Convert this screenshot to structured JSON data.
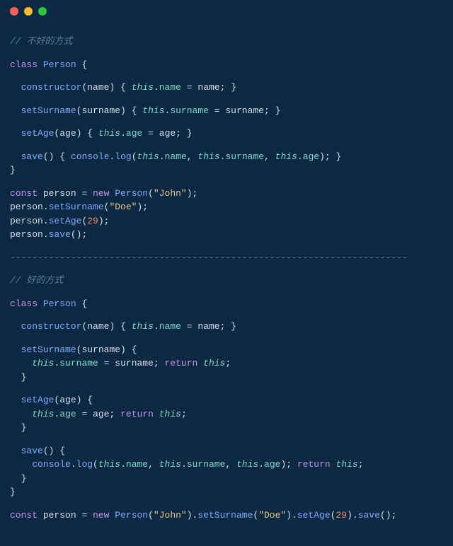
{
  "titlebar": {
    "close": "close",
    "minimize": "minimize",
    "maximize": "maximize"
  },
  "code": {
    "comment_bad": "// 不好的方式",
    "comment_good": "// 好的方式",
    "kw_class": "class",
    "kw_const": "const",
    "kw_new": "new",
    "kw_return": "return",
    "kw_this": "this",
    "cls_Person": "Person",
    "fn_constructor": "constructor",
    "fn_setSurname": "setSurname",
    "fn_setAge": "setAge",
    "fn_save": "save",
    "id_name": "name",
    "id_surname": "surname",
    "id_age": "age",
    "id_person": "person",
    "builtin_console": "console",
    "builtin_log": "log",
    "str_John": "\"John\"",
    "str_Doe": "\"Doe\"",
    "num_29": "29",
    "brace_open": "{",
    "brace_close": "}",
    "paren_open": "(",
    "paren_close": ")",
    "semi": ";",
    "dot": ".",
    "comma": ",",
    "eq": "=",
    "sp": " ",
    "divider": "------------------------------------------------------------------------"
  }
}
